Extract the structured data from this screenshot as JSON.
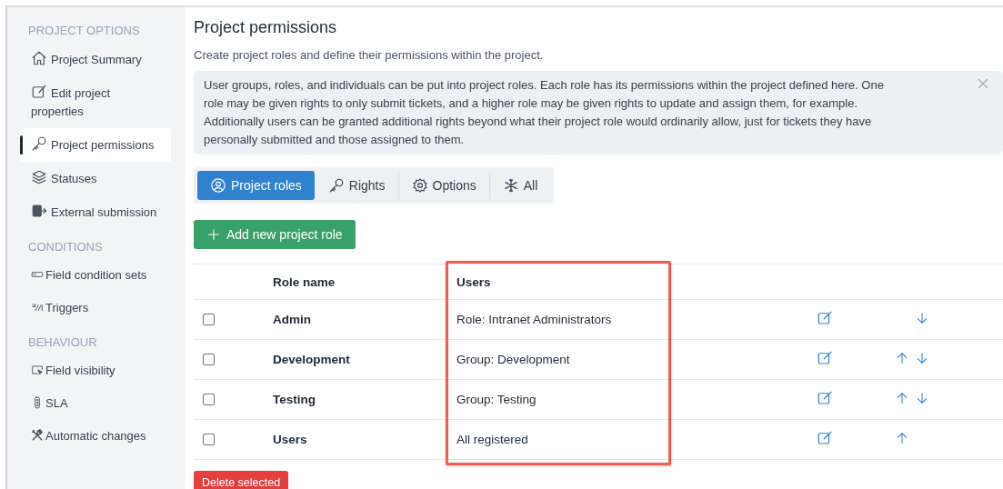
{
  "sidebar": {
    "sections": [
      {
        "title": "PROJECT OPTIONS",
        "items": [
          {
            "label": "Project Summary",
            "selected": false
          },
          {
            "label": "Edit project properties",
            "selected": false
          },
          {
            "label": "Project permissions",
            "selected": true
          },
          {
            "label": "Statuses",
            "selected": false
          },
          {
            "label": "External submission",
            "selected": false
          }
        ]
      },
      {
        "title": "CONDITIONS",
        "items": [
          {
            "label": "Field condition sets",
            "selected": false
          },
          {
            "label": "Triggers",
            "selected": false
          }
        ]
      },
      {
        "title": "BEHAVIOUR",
        "items": [
          {
            "label": "Field visibility",
            "selected": false
          },
          {
            "label": "SLA",
            "selected": false
          },
          {
            "label": "Automatic changes",
            "selected": false
          }
        ]
      }
    ]
  },
  "page": {
    "title": "Project permissions",
    "subtitle": "Create project roles and define their permissions within the project.",
    "notice": "User groups, roles, and individuals can be put into project roles. Each role has its permissions within the project defined here. One role may be given rights to only submit tickets, and a higher role may be given rights to update and assign them, for example. Additionally users can be granted additional rights beyond what their project role would ordinarily allow, just for tickets they have personally submitted and those assigned to them."
  },
  "tabs": [
    {
      "label": "Project roles",
      "selected": true
    },
    {
      "label": "Rights",
      "selected": false
    },
    {
      "label": "Options",
      "selected": false
    },
    {
      "label": "All",
      "selected": false
    }
  ],
  "add_button": "Add new project role",
  "table": {
    "columns": [
      {
        "label": "Role name",
        "highlighted": false
      },
      {
        "label": "Users",
        "highlighted": true
      }
    ],
    "rows": [
      {
        "name": "Admin",
        "users": "Role: Intranet Administrators",
        "checked": false,
        "can_move_up": false,
        "can_move_down": true
      },
      {
        "name": "Development",
        "users": "Group: Development",
        "checked": false,
        "can_move_up": true,
        "can_move_down": true
      },
      {
        "name": "Testing",
        "users": "Group: Testing",
        "checked": false,
        "can_move_up": true,
        "can_move_down": true
      },
      {
        "name": "Users",
        "users": "All registered",
        "checked": false,
        "can_move_up": true,
        "can_move_down": false
      }
    ]
  },
  "delete_button": "Delete selected"
}
